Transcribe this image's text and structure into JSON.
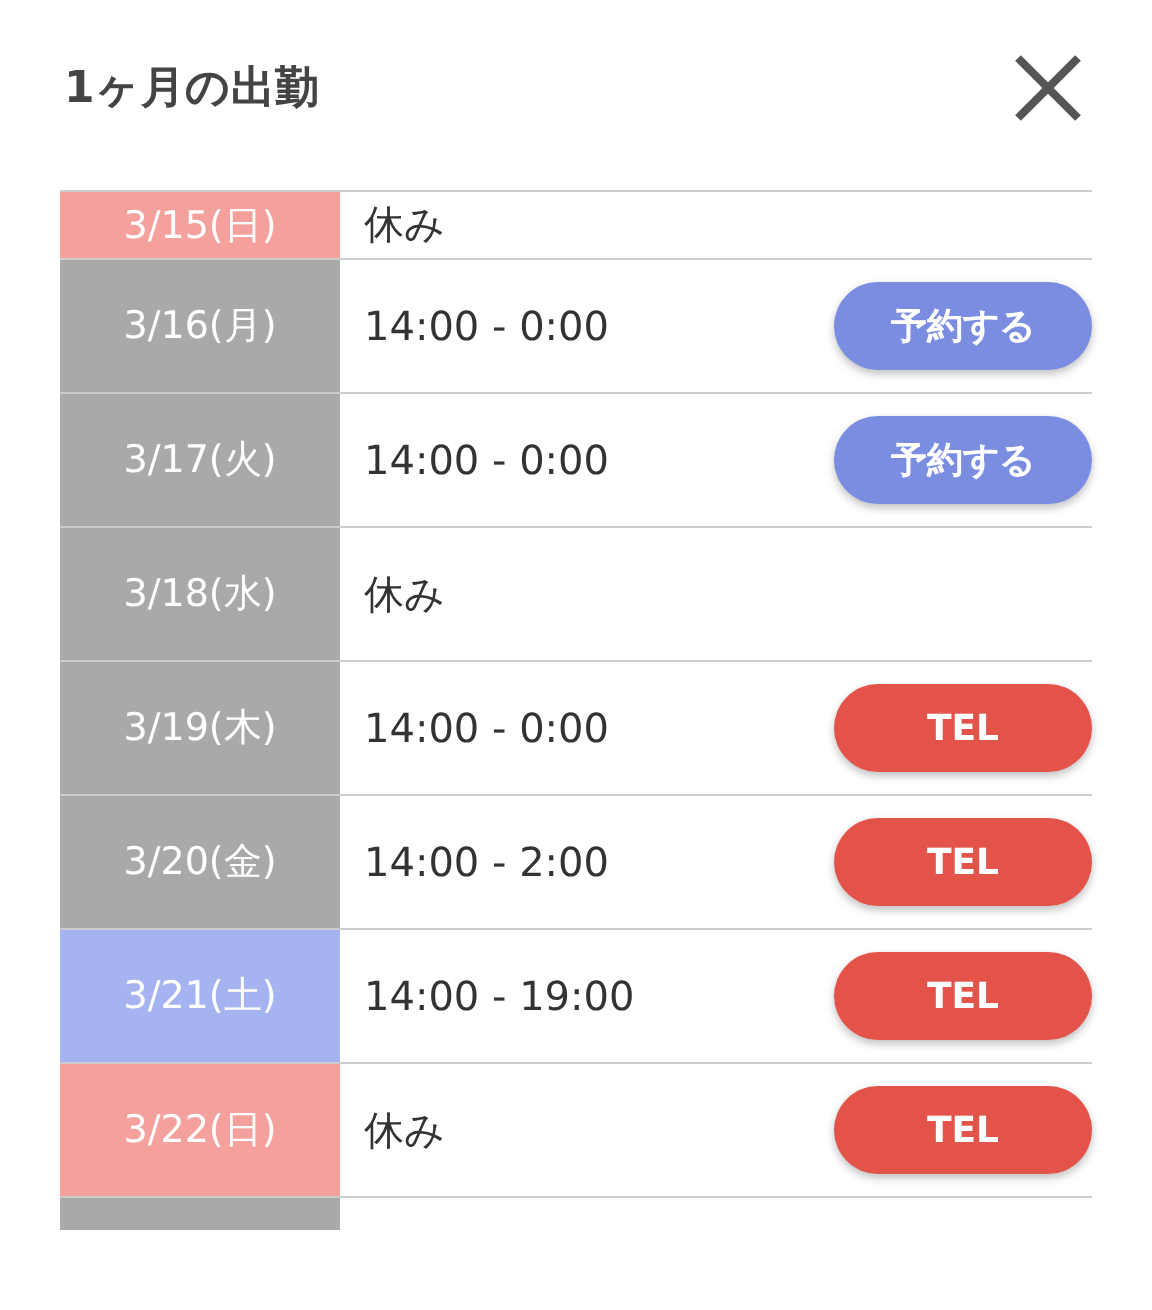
{
  "dialog": {
    "title": "1ヶ月の出勤"
  },
  "rows": [
    {
      "date": "3/15(日)",
      "hours": "休み",
      "color": "#f4a19d",
      "cut": true
    },
    {
      "date": "3/16(月)",
      "hours": "14:00 - 0:00",
      "color": "#a9a9a9",
      "button": {
        "kind": "reserve",
        "label": "予約する"
      }
    },
    {
      "date": "3/17(火)",
      "hours": "14:00 - 0:00",
      "color": "#a9a9a9",
      "button": {
        "kind": "reserve",
        "label": "予約する"
      }
    },
    {
      "date": "3/18(水)",
      "hours": "休み",
      "color": "#a9a9a9"
    },
    {
      "date": "3/19(木)",
      "hours": "14:00 - 0:00",
      "color": "#a9a9a9",
      "button": {
        "kind": "tel",
        "label": "TEL"
      }
    },
    {
      "date": "3/20(金)",
      "hours": "14:00 - 2:00",
      "color": "#a9a9a9",
      "button": {
        "kind": "tel",
        "label": "TEL"
      }
    },
    {
      "date": "3/21(土)",
      "hours": "14:00 - 19:00",
      "color": "#a5b4f0",
      "button": {
        "kind": "tel",
        "label": "TEL"
      }
    },
    {
      "date": "3/22(日)",
      "hours": "休み",
      "color": "#f4a19d",
      "button": {
        "kind": "tel",
        "label": "TEL"
      }
    }
  ]
}
